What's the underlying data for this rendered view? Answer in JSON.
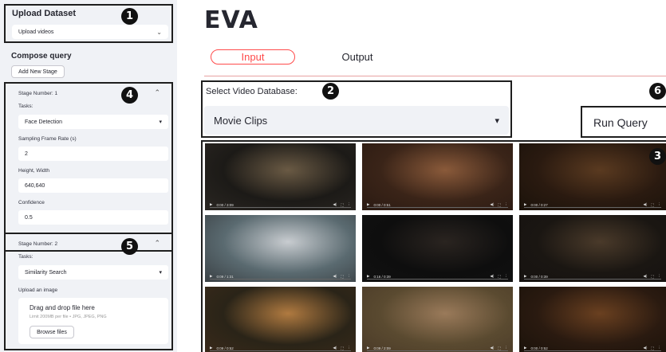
{
  "sidebar": {
    "upload_dataset": {
      "title": "Upload Dataset",
      "select_value": "Upload videos"
    },
    "compose_query": {
      "title": "Compose query",
      "add_stage_label": "Add New Stage"
    },
    "stage1": {
      "stage_label": "Stage Number: 1",
      "tasks_label": "Tasks:",
      "task_value": "Face Detection",
      "rate_label": "Sampling Frame Rate (s)",
      "rate_value": "2",
      "hw_label": "Height, Width",
      "hw_value": "640,640",
      "conf_label": "Confidence",
      "conf_value": "0.5"
    },
    "stage2": {
      "stage_label": "Stage Number: 2",
      "tasks_label": "Tasks:",
      "task_value": "Similarity Search",
      "upload_label": "Upload an image",
      "drag_text": "Drag and drop file here",
      "limit_text": "Limit 200MB per file • JPG, JPEG, PNG",
      "browse_label": "Browse files"
    }
  },
  "main": {
    "title": "EVA",
    "tabs": [
      "Input",
      "Output"
    ],
    "db_label": "Select Video Database:",
    "db_value": "Movie Clips",
    "run_query_label": "Run Query"
  },
  "markers": [
    "1",
    "2",
    "3",
    "4",
    "5",
    "6"
  ],
  "videos": [
    {
      "time": "0:00 / 3:09",
      "colors": [
        "#1c1a17",
        "#6a5a44",
        "#2a2622"
      ]
    },
    {
      "time": "0:00 / 0:51",
      "colors": [
        "#3a2418",
        "#8a5a3a",
        "#2a1a12"
      ]
    },
    {
      "time": "0:00 / 0:27",
      "colors": [
        "#2a1a10",
        "#5a3a20",
        "#1a120a"
      ]
    },
    {
      "time": "0:09 / 1:31",
      "colors": [
        "#5a6a70",
        "#c8ccd0",
        "#3a4044"
      ]
    },
    {
      "time": "0:16 / 0:39",
      "colors": [
        "#0e0e0e",
        "#2a2420",
        "#111"
      ]
    },
    {
      "time": "0:00 / 0:39",
      "colors": [
        "#1a1612",
        "#4a3a2a",
        "#161210"
      ]
    },
    {
      "time": "0:09 / 0:52",
      "colors": [
        "#2a2418",
        "#b07a40",
        "#3a2a1a"
      ]
    },
    {
      "time": "0:09 / 2:09",
      "colors": [
        "#5a4a30",
        "#9a7a5a",
        "#4a3a28"
      ]
    },
    {
      "time": "0:00 / 0:52",
      "colors": [
        "#2a1a10",
        "#6a4020",
        "#1a120a"
      ]
    }
  ]
}
